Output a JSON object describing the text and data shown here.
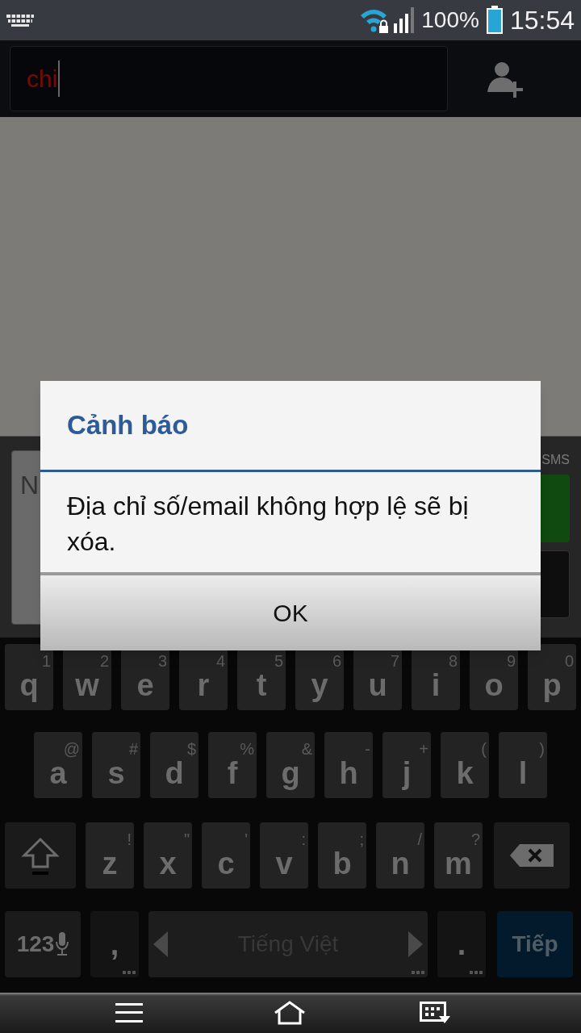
{
  "status_bar": {
    "battery": "100%",
    "time": "15:54"
  },
  "search": {
    "value": "chi"
  },
  "compose": {
    "placeholder": "N",
    "send_label": "SMS"
  },
  "dialog": {
    "title": "Cảnh báo",
    "message": "Địa chỉ số/email không hợp lệ sẽ bị xóa.",
    "button": "OK"
  },
  "keyboard": {
    "rows": [
      [
        {
          "kind": "letter",
          "label": "q",
          "hint": "1"
        },
        {
          "kind": "letter",
          "label": "w",
          "hint": "2"
        },
        {
          "kind": "letter",
          "label": "e",
          "hint": "3"
        },
        {
          "kind": "letter",
          "label": "r",
          "hint": "4"
        },
        {
          "kind": "letter",
          "label": "t",
          "hint": "5"
        },
        {
          "kind": "letter",
          "label": "y",
          "hint": "6"
        },
        {
          "kind": "letter",
          "label": "u",
          "hint": "7"
        },
        {
          "kind": "letter",
          "label": "i",
          "hint": "8"
        },
        {
          "kind": "letter",
          "label": "o",
          "hint": "9"
        },
        {
          "kind": "letter",
          "label": "p",
          "hint": "0"
        }
      ],
      [
        {
          "kind": "letter",
          "label": "a",
          "hint": "@"
        },
        {
          "kind": "letter",
          "label": "s",
          "hint": "#"
        },
        {
          "kind": "letter",
          "label": "d",
          "hint": "$"
        },
        {
          "kind": "letter",
          "label": "f",
          "hint": "%"
        },
        {
          "kind": "letter",
          "label": "g",
          "hint": "&"
        },
        {
          "kind": "letter",
          "label": "h",
          "hint": "-"
        },
        {
          "kind": "letter",
          "label": "j",
          "hint": "+"
        },
        {
          "kind": "letter",
          "label": "k",
          "hint": "("
        },
        {
          "kind": "letter",
          "label": "l",
          "hint": ")"
        }
      ],
      [
        {
          "kind": "shift"
        },
        {
          "kind": "letter",
          "label": "z",
          "hint": "!"
        },
        {
          "kind": "letter",
          "label": "x",
          "hint": "\""
        },
        {
          "kind": "letter",
          "label": "c",
          "hint": "'"
        },
        {
          "kind": "letter",
          "label": "v",
          "hint": ":"
        },
        {
          "kind": "letter",
          "label": "b",
          "hint": ";"
        },
        {
          "kind": "letter",
          "label": "n",
          "hint": "/"
        },
        {
          "kind": "letter",
          "label": "m",
          "hint": "?"
        },
        {
          "kind": "backspace"
        }
      ]
    ],
    "bottom_keys": [
      {
        "kind": "symbols",
        "label": "123"
      },
      {
        "kind": "punct",
        "label": ","
      },
      {
        "kind": "space",
        "label": "Tiếng Việt"
      },
      {
        "kind": "punct",
        "label": "."
      },
      {
        "kind": "action",
        "label": "Tiếp"
      }
    ]
  }
}
